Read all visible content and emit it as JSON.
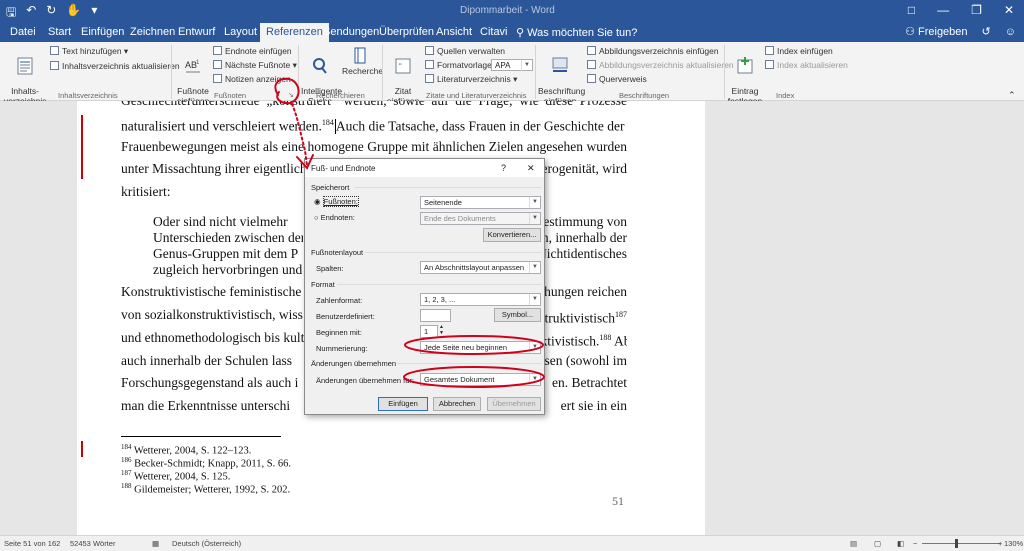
{
  "window": {
    "title": "Dipommarbeit - Word"
  },
  "tabs": [
    "Datei",
    "Start",
    "Einfügen",
    "Zeichnen",
    "Entwurf",
    "Layout",
    "Referenzen",
    "Sendungen",
    "Überprüfen",
    "Ansicht",
    "Citavi"
  ],
  "tellme": "Was möchten Sie tun?",
  "share": "Freigeben",
  "ribbon": {
    "toc_label": "Inhalts-\nverzeichnis",
    "text_add": "Text hinzufügen",
    "toc_update": "Inhaltsverzeichnis aktualisieren",
    "toc_group": "Inhaltsverzeichnis",
    "footnote_insert": "Fußnote\neinfügen",
    "endnote_insert": "Endnote einfügen",
    "next_footnote": "Nächste Fußnote",
    "show_notes": "Notizen anzeigen",
    "fn_group": "Fußnoten",
    "smart_lookup": "Intelligente\nSuche",
    "research": "Recherche",
    "research_group": "Recherchieren",
    "cite_insert": "Zitat\neinfügen",
    "manage_sources": "Quellen verwalten",
    "style_label": "Formatvorlage:",
    "style_value": "APA",
    "bibliography": "Literaturverzeichnis",
    "cite_group": "Zitate und Literaturverzeichnis",
    "caption_insert": "Beschriftung\neinfügen",
    "fig_index_insert": "Abbildungsverzeichnis einfügen",
    "fig_index_update": "Abbildungsverzeichnis aktualisieren",
    "crossref": "Querverweis",
    "caption_group": "Beschriftungen",
    "mark_entry": "Eintrag\nfestlegen",
    "index_insert": "Index einfügen",
    "index_update": "Index aktualisieren",
    "index_group": "Index"
  },
  "document": {
    "lines": [
      "Geschlechterunterschiede „konstruiert“ werden, sowie auf die Frage, wie diese Prozesse",
      "naturalisiert und verschleiert werden.",
      "Auch die Tatsache, dass Frauen in der Geschichte der",
      "Frauenbewegungen meist als eine homogene Gruppe mit ähnlichen Zielen angesehen wurden",
      "unter Missachtung ihrer eigentlichen",
      "Heterogenität, wird",
      "kritisiert:",
      "Oder sind nicht vielmehr",
      "Bestimmung von",
      "Unterschieden zwischen den",
      "Herren, innerhalb der",
      "Genus-Gruppen mit dem P",
      "Nichtidentisches",
      "zugleich hervorbringen und",
      "Konstruktivistische feministische",
      "Forschungen reichen",
      "von sozialkonstruktivistisch, wiss",
      "konstruktivistisch",
      "und ethnomethodologisch bis kultu",
      "Konstruktivistisch.",
      "Aber",
      "auch innerhalb der Schulen lass",
      "sen (sowohl im",
      "Forschungsgegenstand als auch i",
      "en. Betrachtet",
      "man die Erkenntnisse unterschi",
      "ert sie in ein"
    ],
    "sup": {
      "a": "184",
      "b": "187",
      "c": "188"
    },
    "footnotes": [
      {
        "n": "184",
        "t": " Wetterer, 2004, S. 122–123."
      },
      {
        "n": "186",
        "t": " Becker-Schmidt; Knapp, 2011, S. 66."
      },
      {
        "n": "187",
        "t": " Wetterer, 2004, S. 125."
      },
      {
        "n": "188",
        "t": " Gildemeister; Wetterer, 1992, S. 202."
      }
    ],
    "page_number": "51"
  },
  "dialog": {
    "title": "Fuß- und Endnote",
    "help": "?",
    "close": "✕",
    "sec_location": "Speicherort",
    "footnotes_label": "Fußnoten:",
    "footnotes_value": "Seitenende",
    "endnotes_label": "Endnoten:",
    "endnotes_value": "Ende des Dokuments",
    "convert": "Konvertieren...",
    "sec_layout": "Fußnotenlayout",
    "columns_label": "Spalten:",
    "columns_value": "An Abschnittslayout anpassen",
    "sec_format": "Format",
    "number_format_label": "Zahlenformat:",
    "number_format_value": "1, 2, 3, ...",
    "custom_mark_label": "Benutzerdefiniert:",
    "symbol": "Symbol...",
    "start_label": "Beginnen mit:",
    "start_value": "1",
    "numbering_label": "Nummerierung:",
    "numbering_value": "Jede Seite neu beginnen",
    "sec_apply": "Änderungen übernehmen",
    "apply_to_label": "Änderungen übernehmen für:",
    "apply_to_value": "Gesamtes Dokument",
    "insert": "Einfügen",
    "cancel": "Abbrechen",
    "apply": "Übernehmen"
  },
  "status": {
    "page": "Seite 51 von 162",
    "words": "52453 Wörter",
    "language": "Deutsch (Österreich)",
    "zoom": "130%"
  },
  "colors": {
    "brand": "#2b579a",
    "annotation": "#d0021b"
  }
}
